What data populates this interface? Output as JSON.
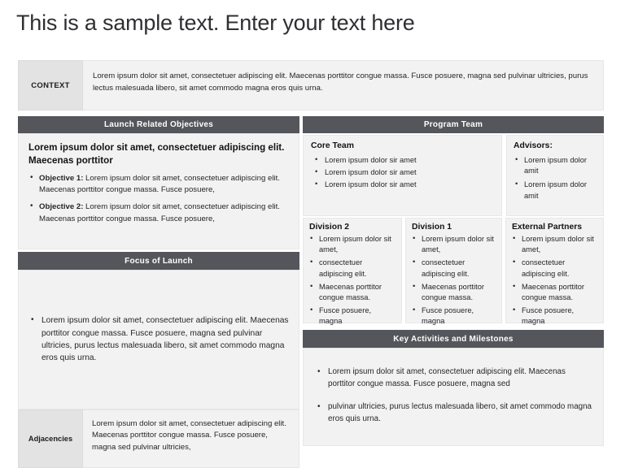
{
  "slide": {
    "title": "This is a sample text. Enter your text here"
  },
  "context": {
    "label": "CONTEXT",
    "body": "Lorem ipsum dolor sit amet, consectetuer adipiscing elit. Maecenas porttitor congue massa. Fusce posuere, magna sed pulvinar ultricies, purus lectus malesuada libero, sit amet commodo magna eros quis urna."
  },
  "objectives": {
    "header": "Launch Related Objectives",
    "intro": "Lorem ipsum dolor sit amet, consectetuer adipiscing elit. Maecenas porttitor",
    "items": [
      {
        "lead": "Objective 1:",
        "text": " Lorem ipsum dolor sit amet, consectetuer adipiscing elit. Maecenas porttitor congue massa. Fusce posuere,"
      },
      {
        "lead": "Objective 2:",
        "text": " Lorem ipsum dolor sit amet, consectetuer adipiscing elit. Maecenas porttitor congue massa. Fusce posuere,"
      }
    ]
  },
  "focus": {
    "header": "Focus of Launch",
    "items": [
      "Lorem ipsum dolor sit amet, consectetuer adipiscing elit. Maecenas porttitor congue massa. Fusce posuere, magna sed pulvinar ultricies, purus lectus malesuada libero, sit amet commodo magna eros quis urna."
    ]
  },
  "adjacencies": {
    "label": "Adjacencies",
    "body": "Lorem ipsum dolor sit amet, consectetuer adipiscing elit. Maecenas porttitor congue massa. Fusce posuere, magna sed pulvinar ultricies,"
  },
  "program_team": {
    "header": "Program Team",
    "core_team": {
      "title": "Core Team",
      "items": [
        "Lorem ipsum dolor sir amet",
        "Lorem ipsum dolor sir amet",
        "Lorem ipsum dolor sir amet"
      ]
    },
    "advisors": {
      "title": "Advisors:",
      "items": [
        "Lorem ipsum dolor amit",
        "Lorem ipsum dolor amit"
      ]
    }
  },
  "divisions": [
    {
      "title": "Division 2",
      "items": [
        "Lorem ipsum dolor sit amet,",
        "consectetuer adipiscing elit.",
        "Maecenas porttitor congue massa.",
        "Fusce posuere, magna"
      ]
    },
    {
      "title": "Division 1",
      "items": [
        "Lorem ipsum dolor sit amet,",
        "consectetuer adipiscing elit.",
        "Maecenas porttitor congue massa.",
        "Fusce posuere, magna"
      ]
    },
    {
      "title": "External Partners",
      "items": [
        "Lorem ipsum dolor sit amet,",
        "consectetuer adipiscing elit.",
        "Maecenas porttitor congue massa.",
        "Fusce posuere, magna"
      ]
    }
  ],
  "key_activities": {
    "header": "Key Activities and Milestones",
    "items": [
      "Lorem ipsum dolor sit amet, consectetuer adipiscing elit. Maecenas porttitor congue massa. Fusce posuere, magna sed",
      "pulvinar ultricies, purus lectus malesuada libero, sit amet commodo magna eros quis urna."
    ]
  },
  "colors": {
    "bar": "#55565b",
    "panel": "#f2f2f2",
    "label_cell": "#e3e3e3",
    "text": "#26262a"
  }
}
